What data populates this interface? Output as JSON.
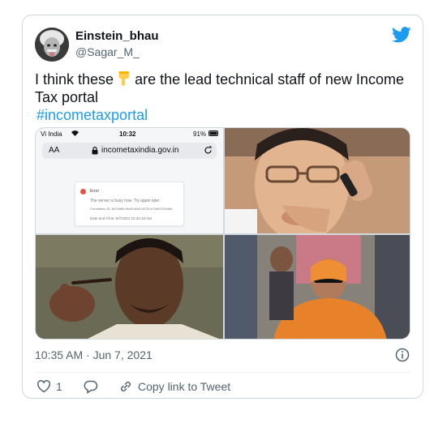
{
  "tweet": {
    "display_name": "Einstein_bhau",
    "handle": "@Sagar_M_",
    "text_part1": "I think these",
    "text_part2": "are the lead technical staff of new Income Tax portal",
    "hashtag": "#incometaxportal",
    "timestamp": "10:35 AM · Jun 7, 2021",
    "like_count": "1",
    "copy_link_label": "Copy link to Tweet"
  },
  "media": {
    "screenshot": {
      "carrier": "Vi India",
      "time": "10:32",
      "battery": "91%",
      "text_size": "AA",
      "url": "incometaxindia.gov.in",
      "error_title": "Error",
      "error_message": "The server is busy now. Try again later",
      "correlation_id": "Correlation ID: 8476df9f-bbd8-d6a3-6075-a74d82379d6a",
      "date_time": "Date and Time: 6/7/2021 10:34:18 AM"
    }
  },
  "icons": [
    "twitter-bird-icon",
    "pointing-down-emoji",
    "info-icon",
    "heart-icon",
    "reply-icon",
    "link-icon",
    "lock-icon",
    "reload-icon",
    "wifi-icon"
  ],
  "colors": {
    "accent": "#1d9bf0",
    "secondary_text": "#536471",
    "border": "#cfd9de",
    "error": "#e0533d"
  }
}
